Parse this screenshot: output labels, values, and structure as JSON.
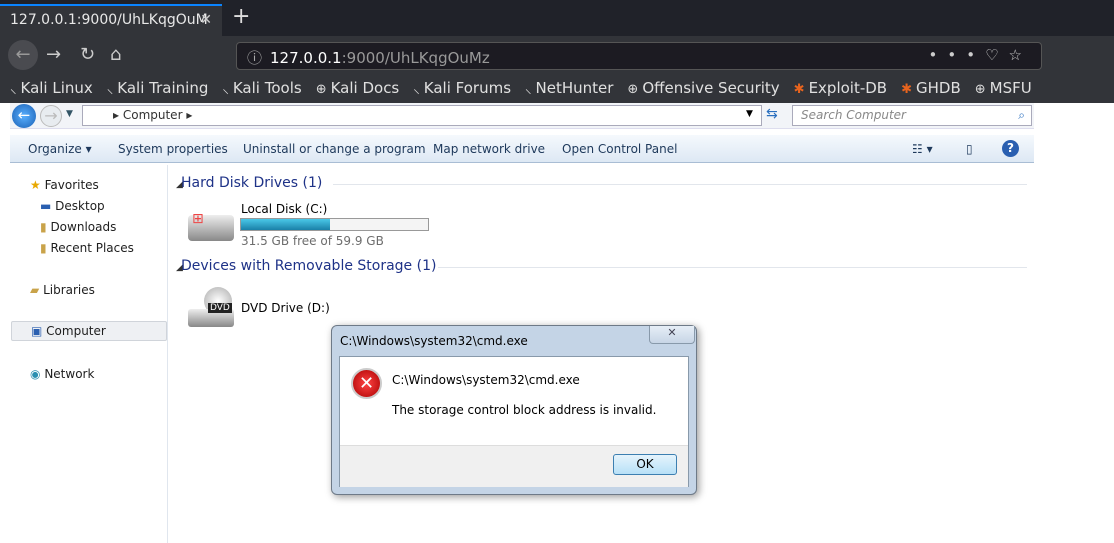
{
  "browser": {
    "tab_title": "127.0.0.1:9000/UhLKqgOuM",
    "url_host": "127.0.0.1",
    "url_rest": ":9000/UhLKqgOuMz",
    "bookmarks": [
      {
        "label": "Kali Linux",
        "icon": "kali-dragon-icon"
      },
      {
        "label": "Kali Training",
        "icon": "kali-dragon-icon"
      },
      {
        "label": "Kali Tools",
        "icon": "kali-dragon-icon"
      },
      {
        "label": "Kali Docs",
        "icon": "globe-icon"
      },
      {
        "label": "Kali Forums",
        "icon": "kali-dragon-icon"
      },
      {
        "label": "NetHunter",
        "icon": "kali-dragon-icon"
      },
      {
        "label": "Offensive Security",
        "icon": "globe-icon"
      },
      {
        "label": "Exploit-DB",
        "icon": "bug-icon"
      },
      {
        "label": "GHDB",
        "icon": "bug-icon"
      },
      {
        "label": "MSFU",
        "icon": "globe-icon"
      }
    ]
  },
  "explorer": {
    "breadcrumb": "Computer",
    "search_placeholder": "Search Computer",
    "toolbar": [
      "Organize",
      "System properties",
      "Uninstall or change a program",
      "Map network drive",
      "Open Control Panel"
    ],
    "sidebar": {
      "favorites": "Favorites",
      "fav_items": [
        "Desktop",
        "Downloads",
        "Recent Places"
      ],
      "libraries": "Libraries",
      "computer": "Computer",
      "network": "Network"
    },
    "groups": {
      "hdd": "Hard Disk Drives (1)",
      "removable": "Devices with Removable Storage (1)"
    },
    "local_disk": {
      "name": "Local Disk (C:)",
      "free_text": "31.5 GB free of 59.9 GB",
      "used_fraction": 0.474
    },
    "dvd": {
      "name": "DVD Drive (D:)",
      "badge": "DVD"
    }
  },
  "dialog": {
    "title": "C:\\Windows\\system32\\cmd.exe",
    "heading": "C:\\Windows\\system32\\cmd.exe",
    "message": "The storage control block address is invalid.",
    "ok": "OK"
  }
}
